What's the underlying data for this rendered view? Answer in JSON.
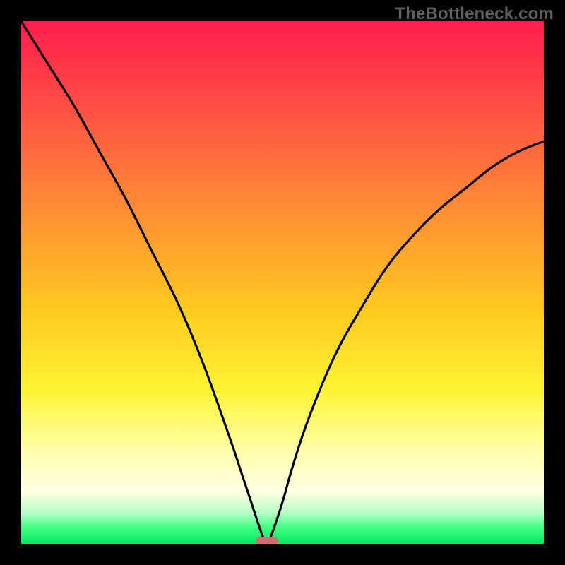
{
  "watermark": "TheBottleneck.com",
  "chart_data": {
    "type": "line",
    "title": "",
    "xlabel": "",
    "ylabel": "",
    "xlim": [
      0,
      100
    ],
    "ylim": [
      0,
      100
    ],
    "axes_visible": false,
    "grid": false,
    "background_gradient": {
      "direction": "vertical",
      "stops": [
        {
          "pos": 0,
          "color": "#ff1e4c"
        },
        {
          "pos": 25,
          "color": "#ff6a3e"
        },
        {
          "pos": 55,
          "color": "#ffc91f"
        },
        {
          "pos": 82,
          "color": "#ffffa8"
        },
        {
          "pos": 94,
          "color": "#b8ffc8"
        },
        {
          "pos": 100,
          "color": "#00e865"
        }
      ]
    },
    "series": [
      {
        "name": "bottleneck-curve",
        "color": "#000000",
        "x": [
          0,
          5,
          10,
          15,
          20,
          25,
          30,
          35,
          40,
          42,
          44,
          46,
          47,
          48,
          50,
          52,
          55,
          60,
          65,
          70,
          75,
          80,
          85,
          90,
          95,
          100
        ],
        "y": [
          100,
          92,
          84,
          75,
          66,
          56,
          46,
          34,
          20,
          14,
          8,
          2,
          0,
          2,
          8,
          15,
          24,
          36,
          45,
          53,
          59,
          64,
          68,
          72,
          75,
          77
        ]
      }
    ],
    "annotations": [
      {
        "name": "minimum-marker",
        "shape": "rounded-rect",
        "color": "#cf6e6e",
        "x": 47,
        "y": 0
      }
    ]
  },
  "frame": {
    "outer_color": "#000000",
    "border_px": 30,
    "inner_w": 740,
    "inner_h": 740
  }
}
